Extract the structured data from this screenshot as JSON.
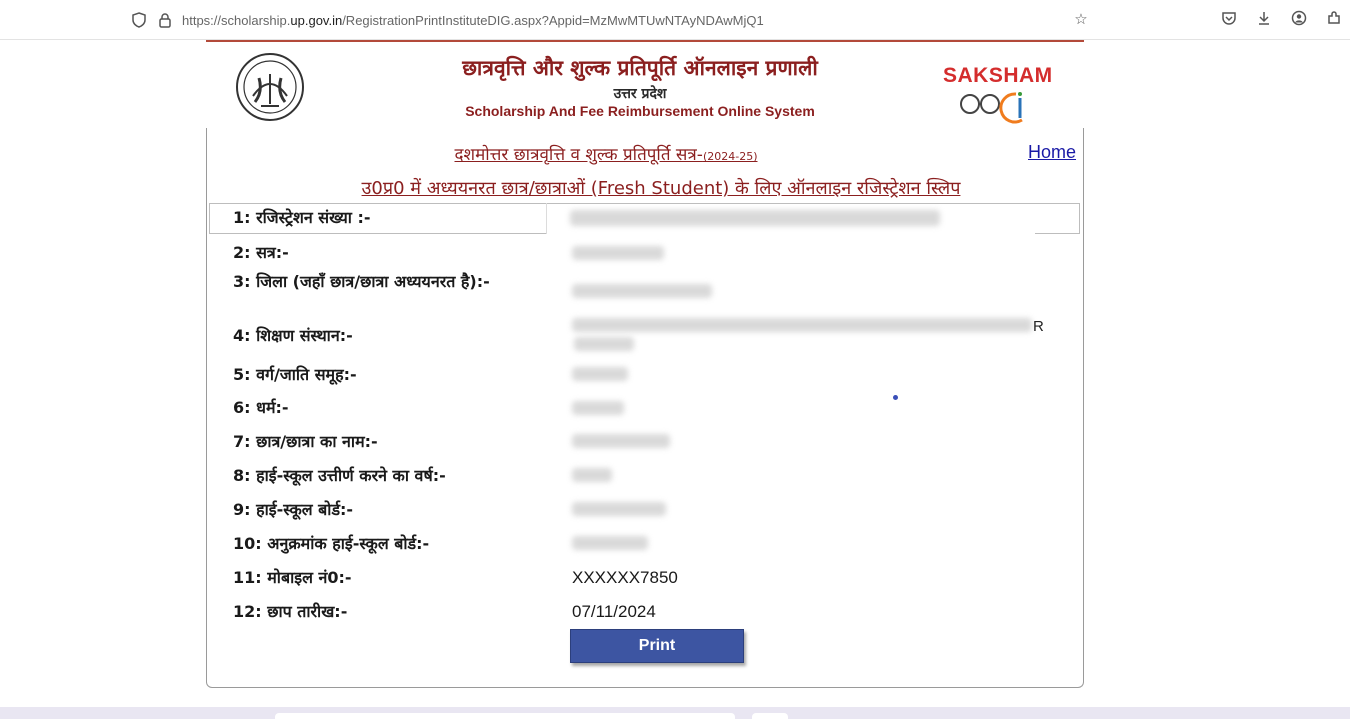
{
  "browser": {
    "url_prefix": "https://scholarship.",
    "url_domain": "up.gov.in",
    "url_suffix": "/RegistrationPrintInstituteDIG.aspx?Appid=MzMwMTUwNTAyNDAwMjQ1"
  },
  "header": {
    "title_hindi": "छात्रवृत्ति और शुल्क प्रतिपूर्ति ऑनलाइन प्रणाली",
    "state": "उत्तर प्रदेश",
    "title_english": "Scholarship And Fee Reimbursement Online System",
    "brand": "SAKSHAM"
  },
  "session": {
    "label": "दशमोत्तर छात्रवृत्ति व शुल्क प्रतिपूर्ति सत्र-",
    "year": "(2024-25)"
  },
  "home_label": "Home",
  "slip_title": "उ0प्र0 में अध्ययनरत छात्र/छात्राओं (Fresh Student) के लिए ऑनलाइन रजिस्ट्रेशन स्लिप",
  "fields": {
    "f1": "1: रजिस्ट्रेशन संख्या :-",
    "f2": "2: सत्र:-",
    "f3": "3: जिला (जहाँ छात्र/छात्रा अध्ययनरत है):-",
    "f4": "4: शिक्षण संस्थान:-",
    "f5": "5: वर्ग/जाति समूह:-",
    "f6": "6: धर्म:-",
    "f7": "7: छात्र/छात्रा का नाम:-",
    "f8": "8: हाई-स्कूल उत्तीर्ण करने का वर्ष:-",
    "f9": "9: हाई-स्कूल बोर्ड:-",
    "f10": "10: अनुक्रमांक हाई-स्कूल बोर्ड:-",
    "f11": "11: मोबाइल नं0:-",
    "f12": "12: छाप तारीख:-"
  },
  "values": {
    "mobile": "XXXXXX7850",
    "print_date": "07/11/2024",
    "stray_char": "R"
  },
  "print_label": "Print"
}
